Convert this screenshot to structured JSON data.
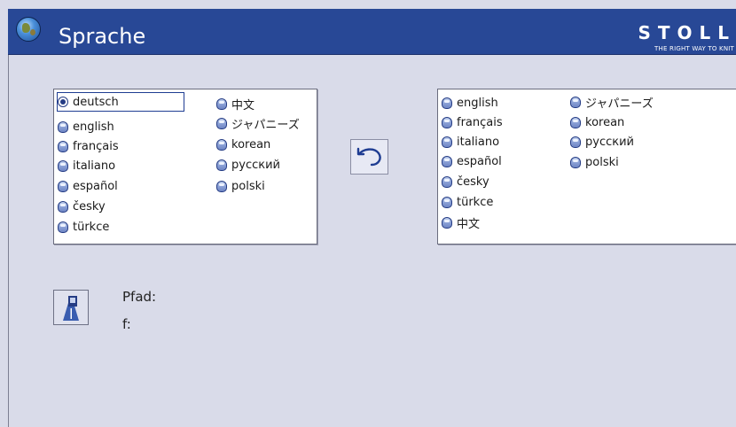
{
  "header": {
    "title": "Sprache",
    "brand": "STOLL",
    "brand_sub": "THE RIGHT WAY TO KNIT",
    "icon": "globe-icon"
  },
  "left_list": {
    "selected": "deutsch",
    "items": [
      "deutsch",
      "english",
      "français",
      "italiano",
      "español",
      "česky",
      "türkce",
      "中文",
      "ジャパニーズ",
      "korean",
      "русский",
      "polski"
    ]
  },
  "right_list": {
    "items": [
      "english",
      "français",
      "italiano",
      "español",
      "česky",
      "türkce",
      "中文",
      "ジャパニーズ",
      "korean",
      "русский",
      "polski"
    ]
  },
  "swap_button": {
    "icon": "undo-arrow-icon"
  },
  "save": {
    "icon": "save-floppy-icon"
  },
  "path_label": "Pfad:",
  "drive_label": "f:",
  "colors": {
    "header": "#284896",
    "background": "#d9dbe9",
    "accent": "#253c84"
  }
}
